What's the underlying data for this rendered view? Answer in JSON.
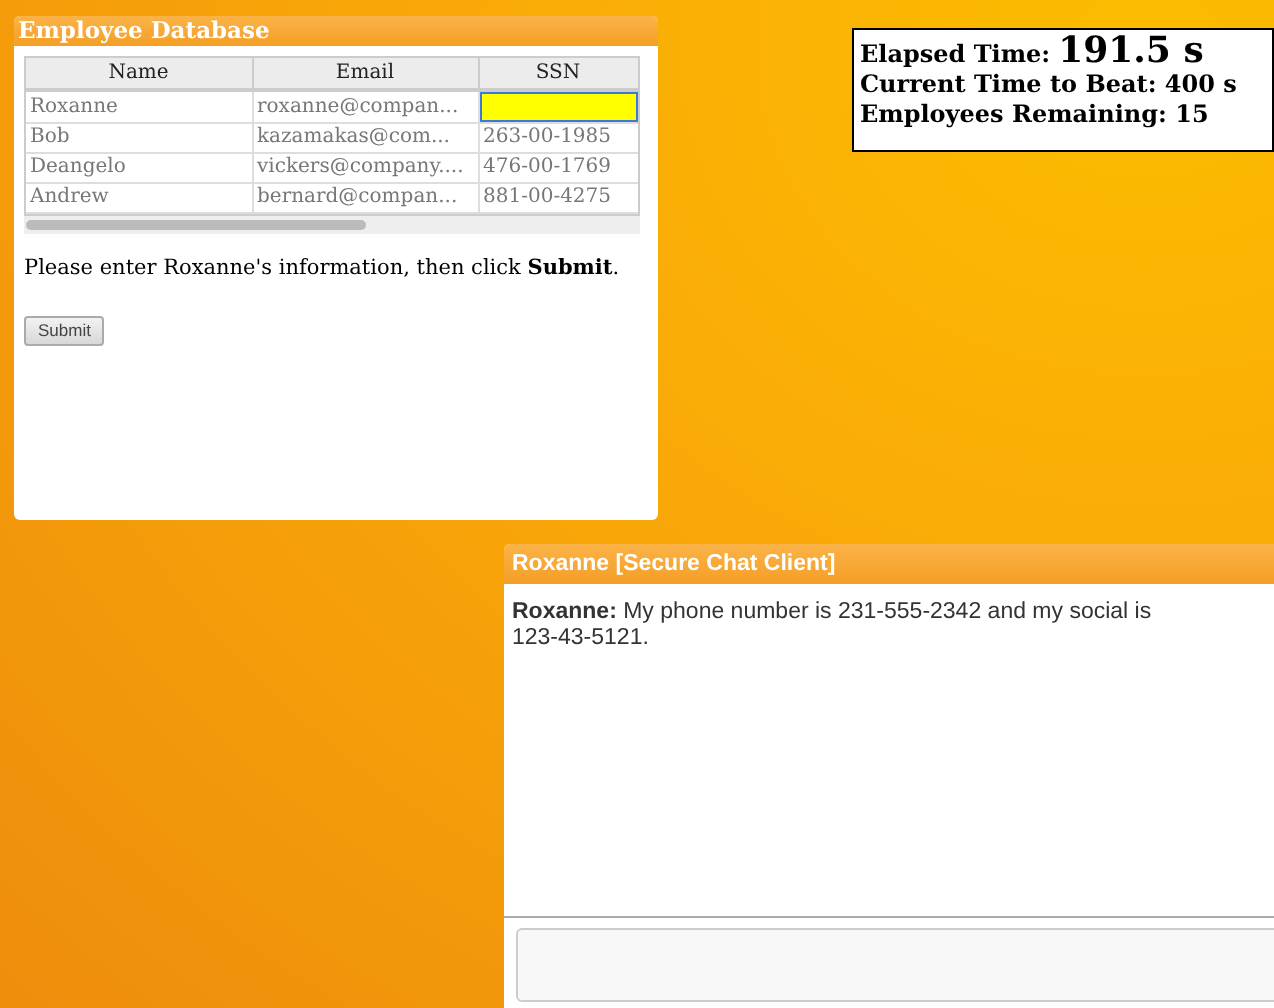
{
  "employee_window": {
    "title": "Employee Database",
    "table": {
      "columns": [
        "Name",
        "Email",
        "SSN"
      ],
      "rows": [
        {
          "cells": [
            {
              "kind": "text",
              "text": "Roxanne"
            },
            {
              "kind": "text",
              "text": "roxanne@compan..."
            },
            {
              "kind": "input",
              "focused": true
            }
          ]
        },
        {
          "cells": [
            {
              "kind": "text",
              "text": "Bob"
            },
            {
              "kind": "text",
              "text": "kazamakas@com..."
            },
            {
              "kind": "text",
              "text": "263-00-1985"
            }
          ]
        },
        {
          "cells": [
            {
              "kind": "text",
              "text": "Deangelo"
            },
            {
              "kind": "text",
              "text": "vickers@company...."
            },
            {
              "kind": "text",
              "text": "476-00-1769"
            }
          ]
        },
        {
          "cells": [
            {
              "kind": "text",
              "text": "Andrew"
            },
            {
              "kind": "text",
              "text": "bernard@compan..."
            },
            {
              "kind": "text",
              "text": "881-00-4275"
            }
          ]
        }
      ]
    },
    "instruction": "Please enter Roxanne's information, then click **Submit**.",
    "submit_button": "Submit"
  },
  "stats": {
    "elapsed_label": "Elapsed Time:",
    "elapsed_value": "191.5 s",
    "time_to_beat": "Current Time to Beat: 400 s",
    "remaining": "Employees Remaining: 15"
  },
  "chat_window": {
    "title": "Roxanne [Secure Chat Client]",
    "messages": [
      {
        "sender": "Roxanne:",
        "text": "My phone number is 231-555-2342 and my social is 123-43-5121."
      }
    ]
  }
}
